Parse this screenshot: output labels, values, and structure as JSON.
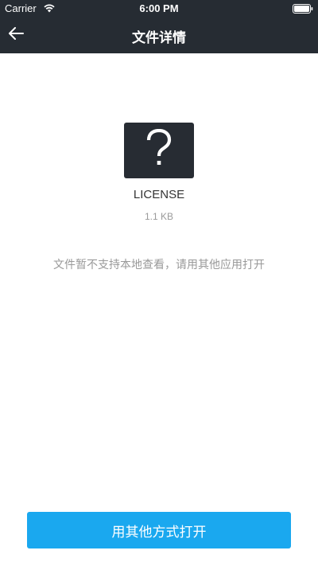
{
  "status_bar": {
    "carrier": "Carrier",
    "time": "6:00 PM"
  },
  "nav": {
    "title": "文件详情",
    "back_icon": "arrow-left-icon"
  },
  "file": {
    "icon": "question-mark-icon",
    "name": "LICENSE",
    "size": "1.1 KB"
  },
  "message": "文件暂不支持本地查看，请用其他应用打开",
  "actions": {
    "open_with_label": "用其他方式打开"
  },
  "colors": {
    "header_bg": "#262c33",
    "file_icon_bg": "#272c33",
    "primary_button": "#1aa8ef",
    "muted_text": "#999999"
  }
}
